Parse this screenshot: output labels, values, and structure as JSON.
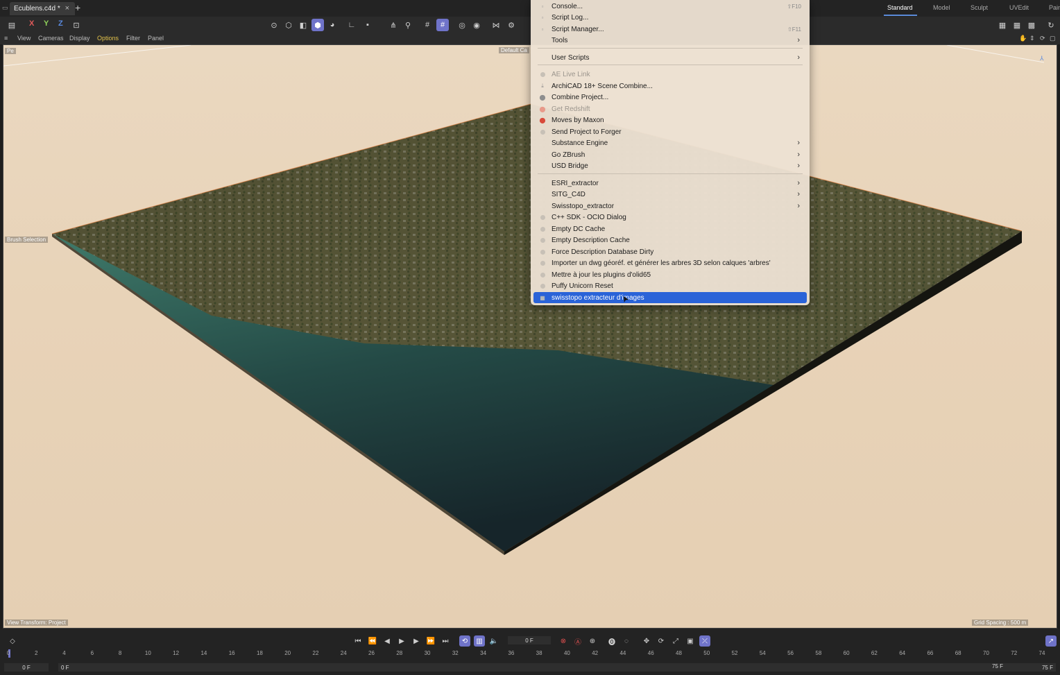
{
  "tabs": {
    "document": "Ecublens.c4d *",
    "close": "×",
    "add": "+"
  },
  "layouts": [
    "Standard",
    "Model",
    "Sculpt",
    "UVEdit",
    "Pain"
  ],
  "toolbar": {
    "axes": [
      "X",
      "Y",
      "Z"
    ]
  },
  "viewport_menu": [
    "View",
    "Cameras",
    "Display",
    "Options",
    "Filter",
    "Panel"
  ],
  "viewport": {
    "view_name": "Pe",
    "camera_label": "Default Ca",
    "brush_label": "Brush Selection",
    "status_left": "View Transform: Project",
    "status_right": "Grid Spacing : 500 m"
  },
  "menu": {
    "items": [
      {
        "label": "Console...",
        "shortcut": "⇧F10"
      },
      {
        "label": "Script Log..."
      },
      {
        "label": "Script Manager...",
        "shortcut": "⇧F11"
      },
      {
        "label": "Tools",
        "submenu": true
      },
      {
        "label": "User Scripts",
        "submenu": true
      },
      {
        "label": "AE Live Link",
        "disabled": true
      },
      {
        "label": "ArchiCAD 18+ Scene Combine..."
      },
      {
        "label": "Combine Project..."
      },
      {
        "label": "Get Redshift",
        "disabled": true
      },
      {
        "label": "Moves by Maxon"
      },
      {
        "label": "Send Project to Forger"
      },
      {
        "label": "Substance Engine",
        "submenu": true
      },
      {
        "label": "Go ZBrush",
        "submenu": true
      },
      {
        "label": "USD Bridge",
        "submenu": true
      },
      {
        "label": "ESRI_extractor",
        "submenu": true
      },
      {
        "label": "SITG_C4D",
        "submenu": true
      },
      {
        "label": "Swisstopo_extractor",
        "submenu": true
      },
      {
        "label": "C++ SDK - OCIO Dialog"
      },
      {
        "label": "Empty DC Cache"
      },
      {
        "label": "Empty Description Cache"
      },
      {
        "label": "Force Description Database Dirty"
      },
      {
        "label": "Importer un dwg géoréf. et générer les arbres 3D selon calques 'arbres'"
      },
      {
        "label": "Mettre à jour les plugins d'olid65"
      },
      {
        "label": "Puffy Unicorn Reset"
      },
      {
        "label": "swisstopo extracteur d'images",
        "selected": true
      }
    ]
  },
  "timeline": {
    "current_frame": "0 F",
    "start": "0 F",
    "start2": "0 F",
    "end": "75 F",
    "end2": "75 F",
    "ticks": [
      "0",
      "2",
      "4",
      "6",
      "8",
      "10",
      "12",
      "14",
      "16",
      "18",
      "20",
      "22",
      "24",
      "26",
      "28",
      "30",
      "32",
      "34",
      "36",
      "38",
      "40",
      "42",
      "44",
      "46",
      "48",
      "50",
      "52",
      "54",
      "56",
      "58",
      "60",
      "62",
      "64",
      "66",
      "68",
      "70",
      "72",
      "74"
    ]
  },
  "colors": {
    "accent": "#6f73c9",
    "selection": "#2a63d8",
    "active_menu": "#e3c24a"
  }
}
